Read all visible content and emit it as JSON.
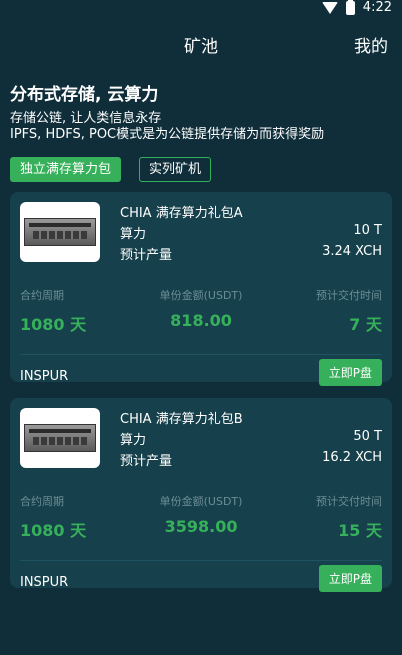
{
  "status": {
    "time": "4:22"
  },
  "header": {
    "title": "矿池",
    "right_link": "我的"
  },
  "intro": {
    "heading": "分布式存储, 云算力",
    "line1": "存储公链, 让人类信息永存",
    "line2": "IPFS, HDFS, POC模式是为公链提供存储为而获得奖励"
  },
  "tabs": [
    "独立满存算力包",
    "实列矿机"
  ],
  "products": [
    {
      "name": "CHIA 满存算力礼包A",
      "power_label": "算力",
      "power_value": "10 T",
      "output_label": "预计产量",
      "output_value": "3.24 XCH",
      "cycle_label": "合约周期",
      "cycle_value": "1080 天",
      "price_label": "单份金额(USDT)",
      "price_value": "818.00",
      "delivery_label": "预计交付时间",
      "delivery_value": "7 天",
      "brand": "INSPUR",
      "buy_label": "立即P盘"
    },
    {
      "name": "CHIA 满存算力礼包B",
      "power_label": "算力",
      "power_value": "50 T",
      "output_label": "预计产量",
      "output_value": "16.2 XCH",
      "cycle_label": "合约周期",
      "cycle_value": "1080 天",
      "price_label": "单份金额(USDT)",
      "price_value": "3598.00",
      "delivery_label": "预计交付时间",
      "delivery_value": "15 天",
      "brand": "INSPUR",
      "buy_label": "立即P盘"
    }
  ],
  "colors": {
    "background": "#0f2e3a",
    "card": "#16404b",
    "accent": "#36b05a",
    "muted": "#6b8d96"
  }
}
